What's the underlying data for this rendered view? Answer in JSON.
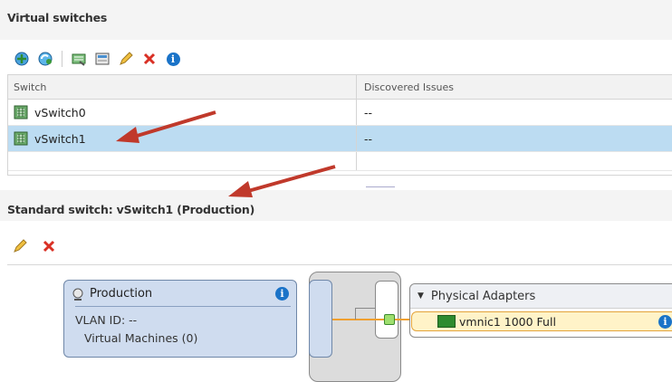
{
  "vswitches": {
    "title": "Virtual switches",
    "toolbar": {
      "icons": [
        "add-networking-icon",
        "refresh-icon",
        "migrate-adapter-icon",
        "manage-adapters-icon",
        "edit-icon",
        "remove-icon",
        "info-icon"
      ]
    },
    "columns": [
      "Switch",
      "Discovered Issues"
    ],
    "rows": [
      {
        "name": "vSwitch0",
        "issues": "--"
      },
      {
        "name": "vSwitch1",
        "issues": "--"
      }
    ]
  },
  "detail": {
    "title": "Standard switch: vSwitch1 (Production)",
    "portgroup": {
      "name": "Production",
      "vlan": "VLAN ID: --",
      "vms": "Virtual Machines (0)"
    },
    "physical_adapters": {
      "header": "Physical Adapters",
      "adapter": "vmnic1  1000  Full"
    }
  },
  "colors": {
    "selection": "#bcdcf2",
    "arrow": "#c0392b",
    "link": "#f0a030",
    "remove": "#d93025"
  }
}
